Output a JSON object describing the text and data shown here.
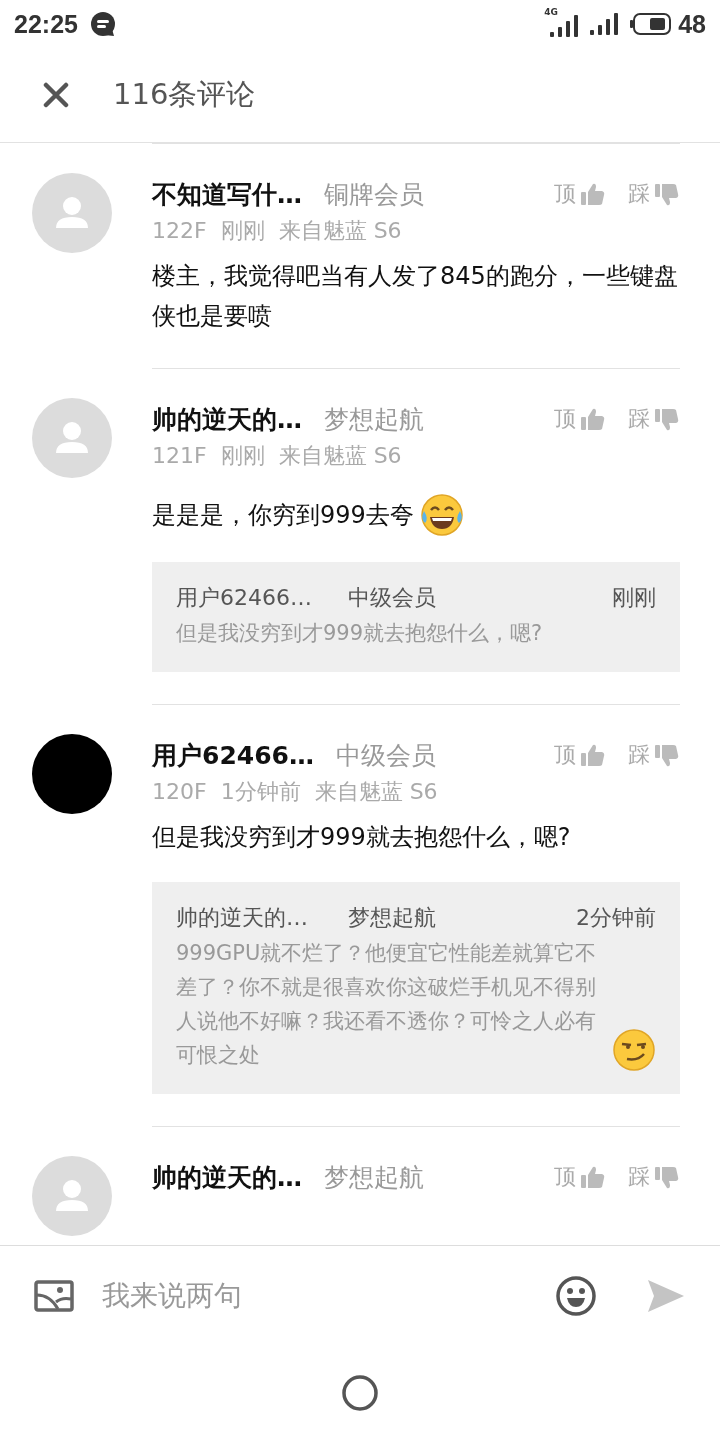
{
  "status_bar": {
    "time": "22:25",
    "network": "4G",
    "battery": "48"
  },
  "header": {
    "title": "116条评论"
  },
  "comments": [
    {
      "avatar": {
        "kind": "default"
      },
      "name": "不知道写什…",
      "tier": "铜牌会员",
      "up": "顶",
      "down": "踩",
      "floor": "122F",
      "time": "刚刚",
      "device": "来自魅蓝 S6",
      "body": "楼主，我觉得吧当有人发了845的跑分，一些键盘侠也是要喷"
    },
    {
      "avatar": {
        "kind": "default"
      },
      "name": "帅的逆天的…",
      "tier": "梦想起航",
      "up": "顶",
      "down": "踩",
      "floor": "121F",
      "time": "刚刚",
      "device": "来自魅蓝 S6",
      "body": "是是是，你穷到999去夸",
      "body_emoji": {
        "kind": "laughing"
      },
      "quote": {
        "name": "用户62466…",
        "tier": "中级会员",
        "time": "刚刚",
        "text": "但是我没穷到才999就去抱怨什么，嗯?"
      }
    },
    {
      "avatar": {
        "kind": "dark"
      },
      "name": "用户62466…",
      "tier": "中级会员",
      "up": "顶",
      "down": "踩",
      "floor": "120F",
      "time": "1分钟前",
      "device": "来自魅蓝 S6",
      "body": "但是我没穷到才999就去抱怨什么，嗯?",
      "quote": {
        "name": "帅的逆天的…",
        "tier": "梦想起航",
        "time": "2分钟前",
        "text": "999GPU就不烂了？他便宜它性能差就算它不差了？你不就是很喜欢你这破烂手机见不得别人说他不好嘛？我还看不透你？可怜之人必有可恨之处",
        "emoji": {
          "kind": "smirk"
        }
      }
    },
    {
      "avatar": {
        "kind": "default"
      },
      "name": "帅的逆天的…",
      "tier": "梦想起航",
      "up": "顶",
      "down": "踩"
    }
  ],
  "composer": {
    "placeholder": "我来说两句"
  }
}
